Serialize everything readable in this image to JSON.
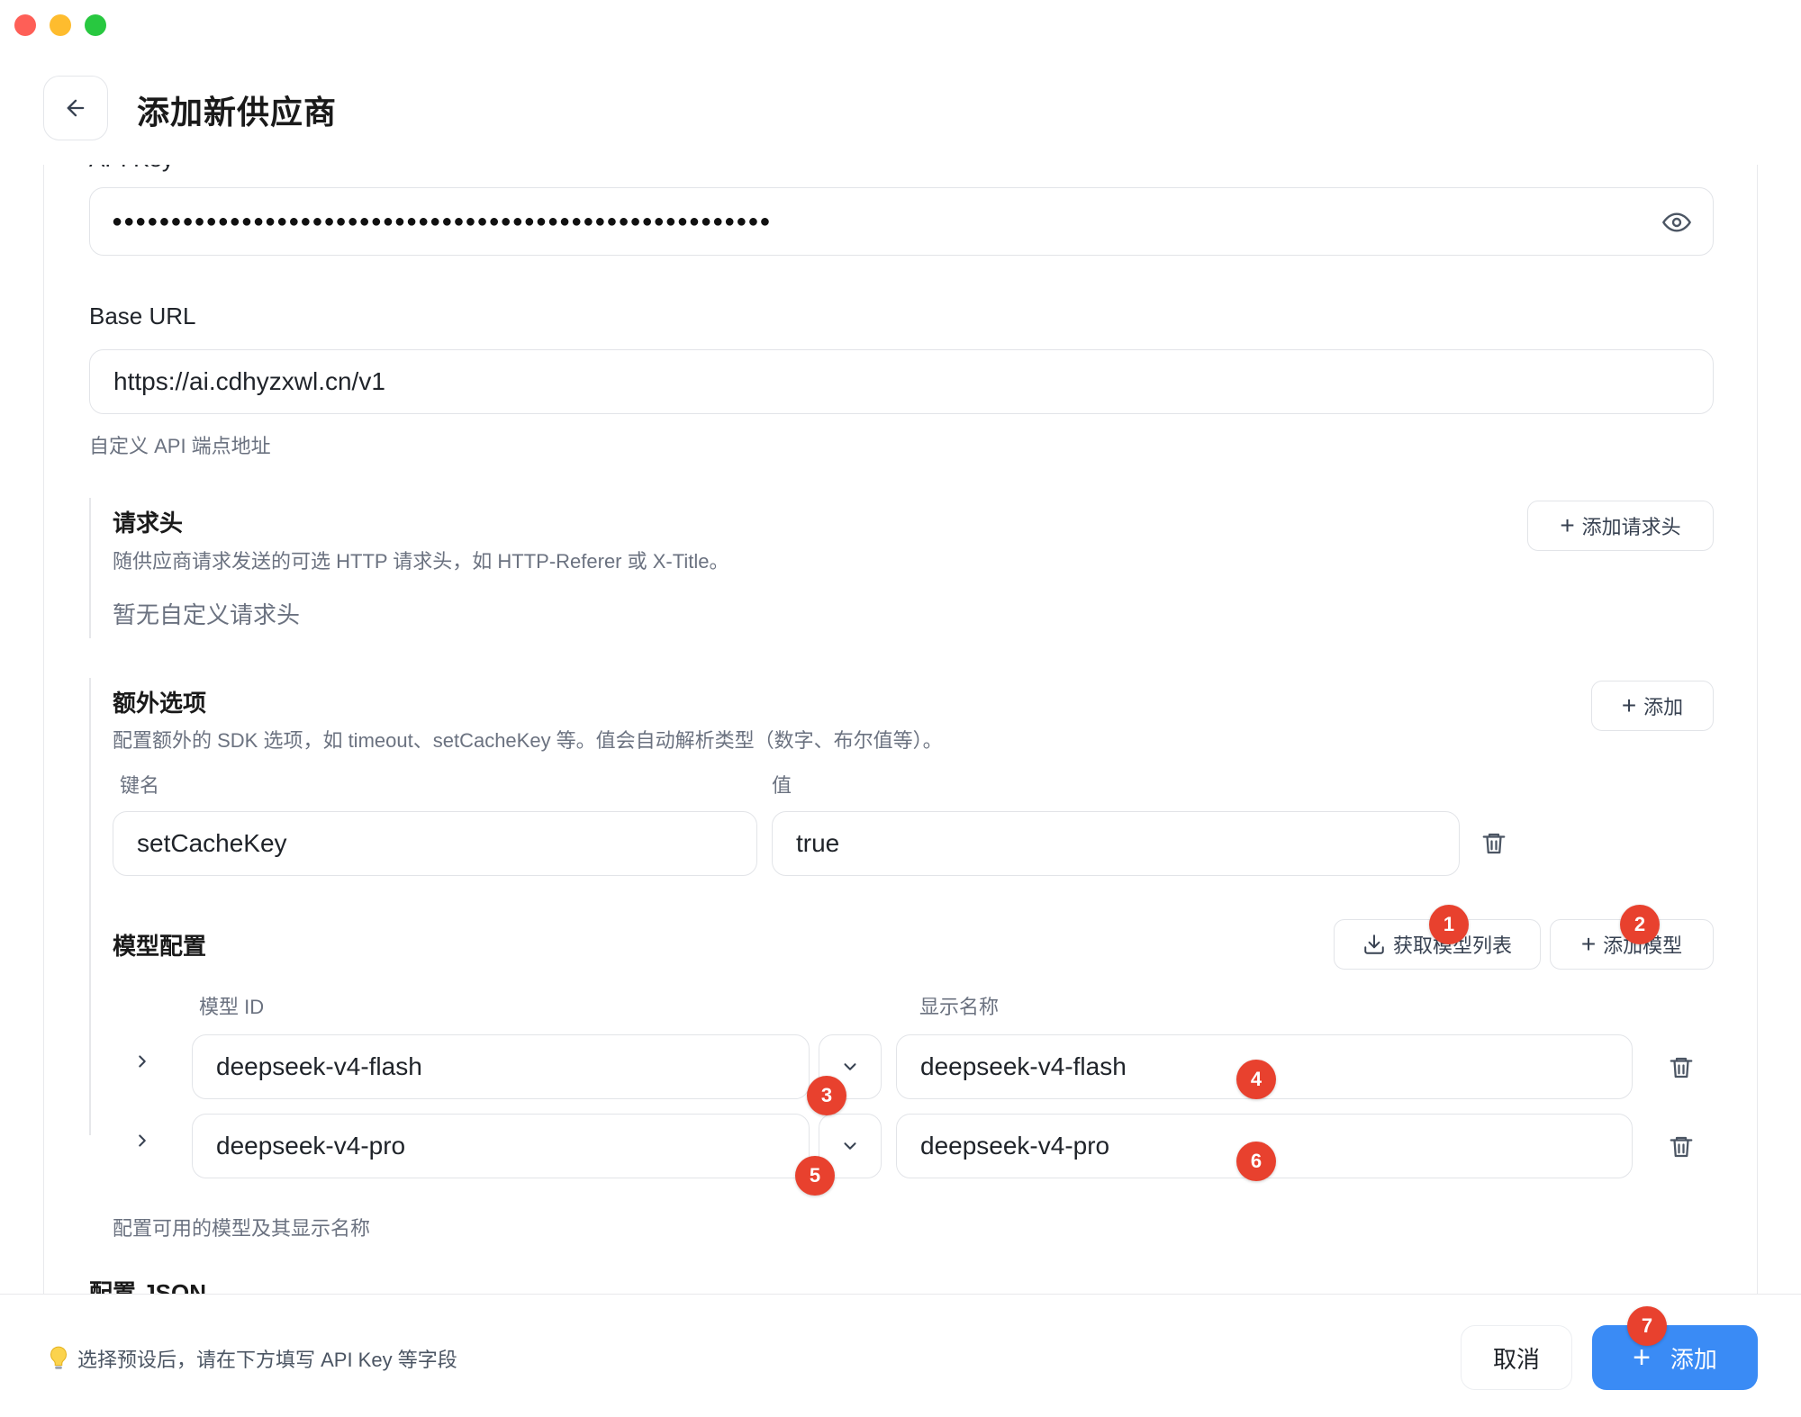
{
  "window": {
    "title": "添加新供应商"
  },
  "header": {
    "title": "添加新供应商",
    "back_icon": "arrow-left-icon"
  },
  "api_key": {
    "label_partial": "API Key",
    "masked_value": "●●●●●●●●●●●●●●●●●●●●●●●●●●●●●●●●●●●●●●●●●●●●●●●●●●●●●●●●"
  },
  "base_url": {
    "label": "Base URL",
    "value": "https://ai.cdhyzxwl.cn/v1",
    "help": "自定义 API 端点地址"
  },
  "headers_section": {
    "title": "请求头",
    "description": "随供应商请求发送的可选 HTTP 请求头，如 HTTP-Referer 或 X-Title。",
    "add_label": "添加请求头",
    "empty_text": "暂无自定义请求头"
  },
  "extra_options": {
    "title": "额外选项",
    "description": "配置额外的 SDK 选项，如 timeout、setCacheKey 等。值会自动解析类型（数字、布尔值等）。",
    "add_label": "添加",
    "key_header": "键名",
    "value_header": "值",
    "rows": [
      {
        "key": "setCacheKey",
        "value": "true"
      }
    ]
  },
  "models": {
    "title": "模型配置",
    "fetch_label": "获取模型列表",
    "add_label": "添加模型",
    "id_header": "模型 ID",
    "name_header": "显示名称",
    "rows": [
      {
        "id": "deepseek-v4-flash",
        "name": "deepseek-v4-flash"
      },
      {
        "id": "deepseek-v4-pro",
        "name": "deepseek-v4-pro"
      }
    ],
    "help": "配置可用的模型及其显示名称"
  },
  "config_json": {
    "title": "配置 JSON"
  },
  "badges": [
    "1",
    "2",
    "3",
    "4",
    "5",
    "6",
    "7"
  ],
  "footer": {
    "hint": "选择预设后，请在下方填写 API Key 等字段",
    "cancel_label": "取消",
    "add_label": "添加"
  },
  "colors": {
    "primary": "#3a8bf5",
    "badge": "#e8412e",
    "border": "#e2e4e8"
  }
}
